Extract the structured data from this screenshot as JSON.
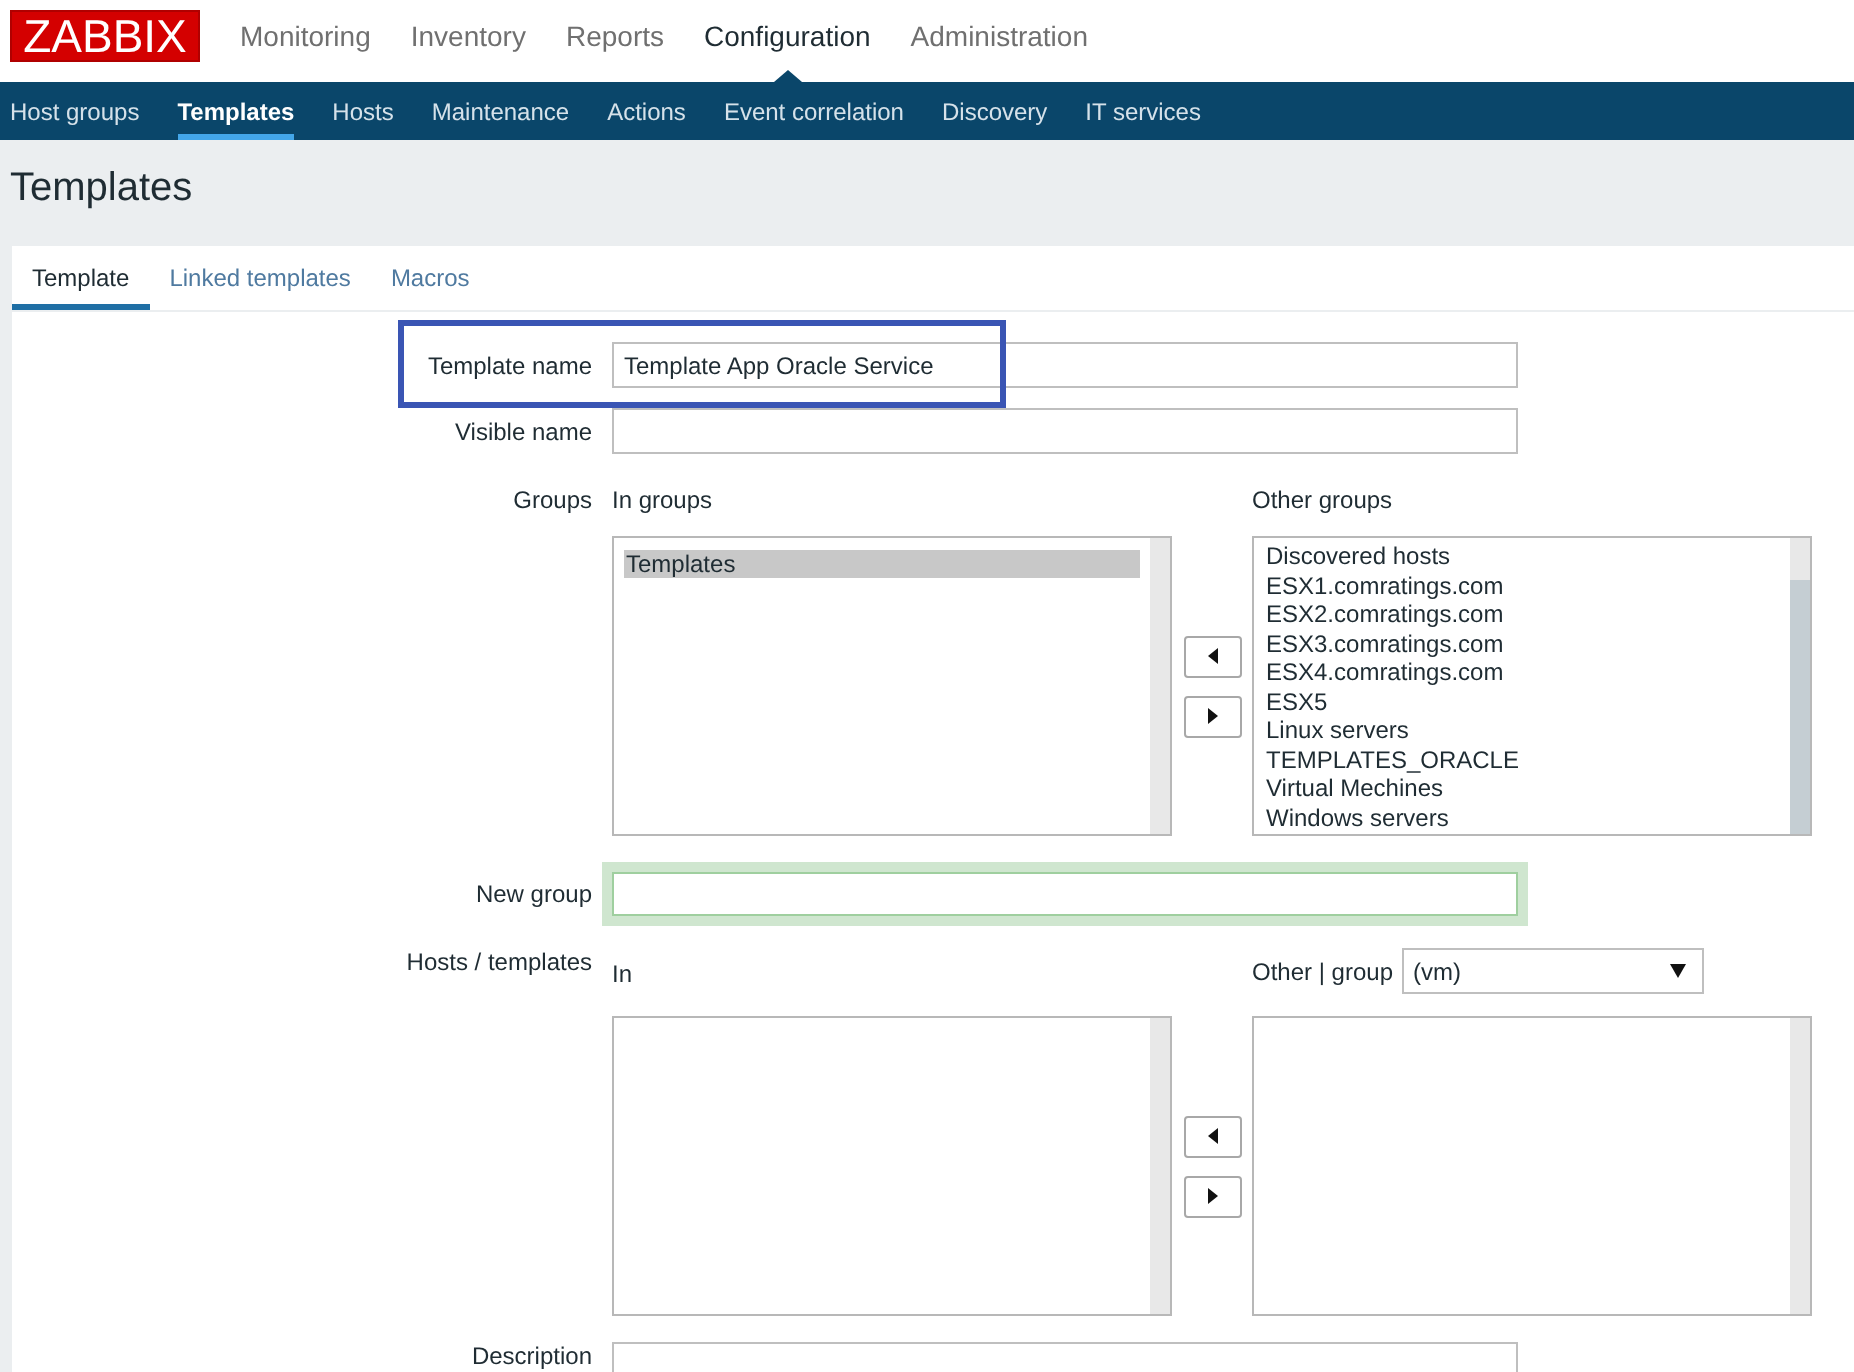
{
  "header": {
    "logo": "ZABBIX",
    "menu": [
      {
        "label": "Monitoring",
        "selected": false
      },
      {
        "label": "Inventory",
        "selected": false
      },
      {
        "label": "Reports",
        "selected": false
      },
      {
        "label": "Configuration",
        "selected": true
      },
      {
        "label": "Administration",
        "selected": false
      }
    ]
  },
  "submenu": [
    {
      "label": "Host groups",
      "selected": false
    },
    {
      "label": "Templates",
      "selected": true
    },
    {
      "label": "Hosts",
      "selected": false
    },
    {
      "label": "Maintenance",
      "selected": false
    },
    {
      "label": "Actions",
      "selected": false
    },
    {
      "label": "Event correlation",
      "selected": false
    },
    {
      "label": "Discovery",
      "selected": false
    },
    {
      "label": "IT services",
      "selected": false
    }
  ],
  "page_title": "Templates",
  "tabs": [
    {
      "label": "Template",
      "selected": true
    },
    {
      "label": "Linked templates",
      "selected": false
    },
    {
      "label": "Macros",
      "selected": false
    }
  ],
  "form": {
    "template_name": {
      "label": "Template name",
      "value": "Template App Oracle Service",
      "highlighted": true
    },
    "visible_name": {
      "label": "Visible name"
    },
    "groups": {
      "label": "Groups",
      "in_heading": "In groups",
      "in_items": [
        {
          "label": "Templates",
          "selected": true
        }
      ],
      "other_heading": "Other groups",
      "other_items": [
        {
          "label": "Discovered hosts",
          "selected": false
        },
        {
          "label": "ESX1.comratings.com",
          "selected": false
        },
        {
          "label": "ESX2.comratings.com",
          "selected": false
        },
        {
          "label": "ESX3.comratings.com",
          "selected": false
        },
        {
          "label": "ESX4.comratings.com",
          "selected": false
        },
        {
          "label": "ESX5",
          "selected": false
        },
        {
          "label": "Linux servers",
          "selected": false
        },
        {
          "label": "TEMPLATES_ORACLE",
          "selected": false
        },
        {
          "label": "Virtual Mechines",
          "selected": false
        },
        {
          "label": "Windows servers",
          "selected": false
        }
      ]
    },
    "new_group": {
      "label": "New group",
      "focused": true
    },
    "hosts_templates": {
      "label": "Hosts / templates",
      "in_heading": "In",
      "other_heading": "Other | group",
      "group_filter": "(vm)"
    },
    "description": {
      "label": "Description"
    }
  }
}
